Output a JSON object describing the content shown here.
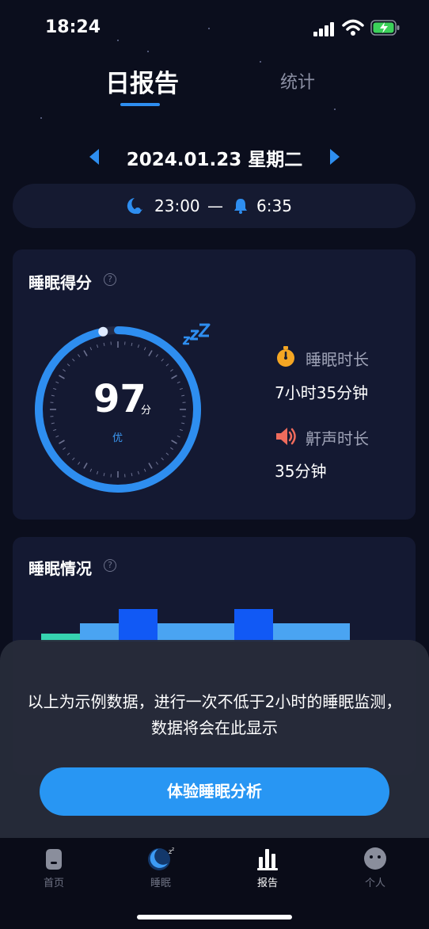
{
  "status_bar": {
    "time": "18:24"
  },
  "tabs": {
    "report": "日报告",
    "stats": "统计"
  },
  "date": {
    "text": "2024.01.23  星期二"
  },
  "bedtime": {
    "sleep": "23:00",
    "dash": "—",
    "wake": "6:35"
  },
  "score_card": {
    "title": "睡眠得分",
    "help": "?",
    "score": "97",
    "unit": "分",
    "grade": "优",
    "score_value": 97,
    "sleep_duration_label": "睡眠时长",
    "sleep_duration_value": "7小时35分钟",
    "snore_label": "鼾声时长",
    "snore_value": "35分钟"
  },
  "condition_card": {
    "title": "睡眠情况",
    "help": "?"
  },
  "overlay": {
    "message": "以上为示例数据，进行一次不低于2小时的睡眠监测，数据将会在此显示",
    "button": "体验睡眠分析"
  },
  "nav": {
    "home": "首页",
    "sleep": "睡眠",
    "report": "报告",
    "profile": "个人"
  },
  "colors": {
    "accent": "#2e8ef0",
    "button": "#2896f3",
    "background": "#0b0e1d",
    "card": "#141932"
  }
}
